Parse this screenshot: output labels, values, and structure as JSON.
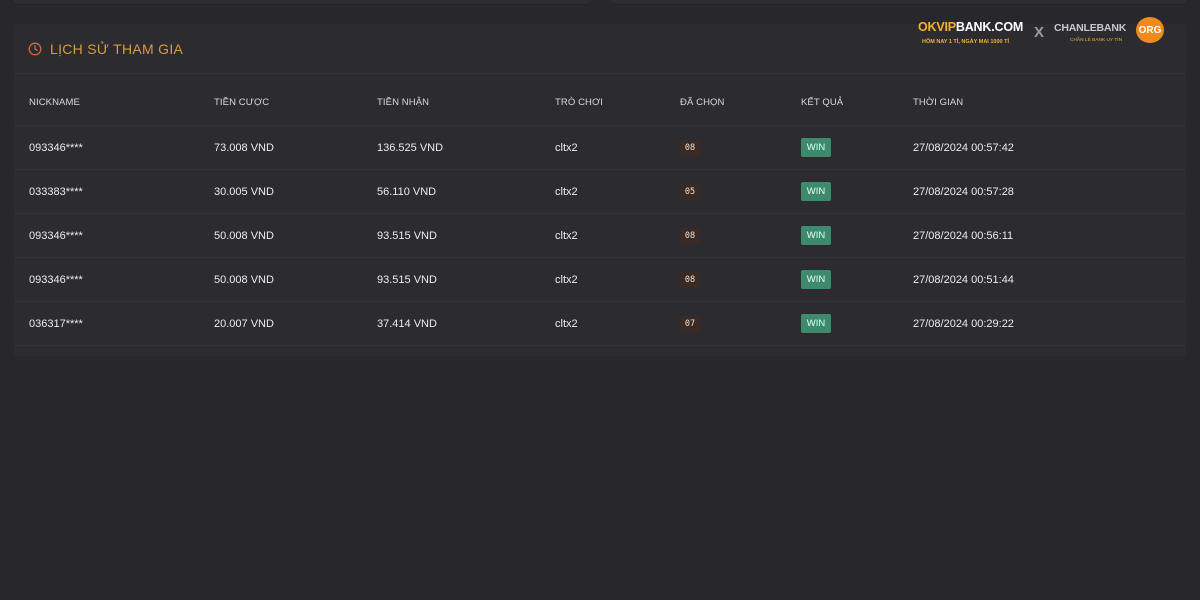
{
  "panel": {
    "title": "LỊCH SỬ THAM GIA",
    "icon": "clock-icon"
  },
  "brand": {
    "okvip_text": "OKVIP",
    "bank_text": "BANK.COM",
    "slogan": "HÔM NAY 1 TỈ, NGÀY MAI 1000 TỈ",
    "x_text": "X",
    "chanlebank_text": "CHANLEBANK",
    "org_text": "ORG",
    "chanlebank_tag": "CHẴN LẺ BANK UY TÍN"
  },
  "table": {
    "headers": {
      "nickname": "NICKNAME",
      "bet": "TIỀN CƯỢC",
      "received": "TIỀN NHẬN",
      "game": "TRÒ CHƠI",
      "picked": "ĐÃ CHỌN",
      "result": "KẾT QUẢ",
      "time": "THỜI GIAN"
    },
    "rows": [
      {
        "nickname": "093346****",
        "bet": "73.008 VND",
        "received": "136.525 VND",
        "game": "cltx2",
        "picked": "08",
        "result": "WIN",
        "time": "27/08/2024 00:57:42"
      },
      {
        "nickname": "033383****",
        "bet": "30.005 VND",
        "received": "56.110 VND",
        "game": "cltx2",
        "picked": "05",
        "result": "WIN",
        "time": "27/08/2024 00:57:28"
      },
      {
        "nickname": "093346****",
        "bet": "50.008 VND",
        "received": "93.515 VND",
        "game": "cltx2",
        "picked": "08",
        "result": "WIN",
        "time": "27/08/2024 00:56:11"
      },
      {
        "nickname": "093346****",
        "bet": "50.008 VND",
        "received": "93.515 VND",
        "game": "cltx2",
        "picked": "08",
        "result": "WIN",
        "time": "27/08/2024 00:51:44"
      },
      {
        "nickname": "036317****",
        "bet": "20.007 VND",
        "received": "37.414 VND",
        "game": "cltx2",
        "picked": "07",
        "result": "WIN",
        "time": "27/08/2024 00:29:22"
      }
    ]
  },
  "colors": {
    "background": "#28272c",
    "panel": "#2c2b30",
    "accent": "#d79a43",
    "win_badge": "#3e8a6e",
    "pick_badge": "#3a2a26"
  }
}
